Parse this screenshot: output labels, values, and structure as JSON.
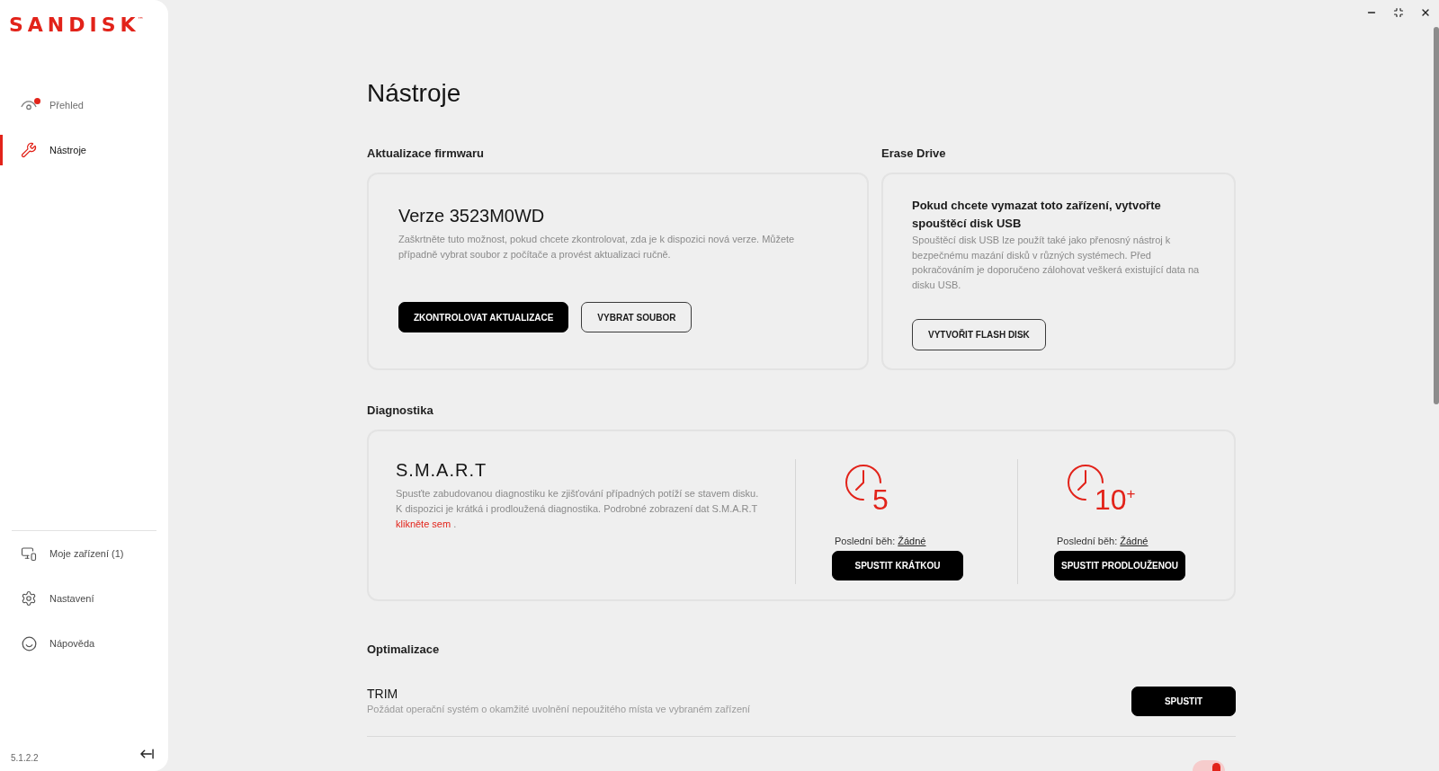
{
  "sidebar": {
    "logo": "SANDISK$^{™}$",
    "nav_items": [
      {
        "label": "Přehled",
        "selected": false,
        "notification": true
      },
      {
        "label": "Nástroje",
        "selected": true,
        "notification": false
      }
    ],
    "bottom_items": [
      {
        "label": "Moje zařízení (1)"
      },
      {
        "label": "Nastavení"
      },
      {
        "label": "Nápověda"
      }
    ],
    "version": "5.1.2.2"
  },
  "page": {
    "title": "Nástroje"
  },
  "firmware": {
    "heading": "Aktualizace firmwaru",
    "title": "Verze 3523M0WD",
    "description": "Zaškrtněte tuto možnost, pokud chcete zkontrolovat, zda je k dispozici nová verze. Můžete případně vybrat soubor z počítače a provést aktualizaci ručně.",
    "buttons": [
      {
        "label": "ZKONTROLOVAT AKTUALIZACE",
        "kind": "primary"
      },
      {
        "label": "VYBRAT SOUBOR",
        "kind": "outline"
      }
    ]
  },
  "erase_drive": {
    "heading": "Erase Drive",
    "title": "Pokud chcete vymazat toto zařízení, vytvořte spouštěcí disk USB",
    "description": "Spouštěcí disk USB lze použít také jako přenosný nástroj k bezpečnému mazání disků v různých systémech. Před pokračováním je doporučeno zálohovat veškerá existující data na disku USB.",
    "button": {
      "label": "VYTVOŘIT FLASH DISK",
      "kind": "outline"
    }
  },
  "diagnostics": {
    "heading": "Diagnostika",
    "title": "S.M.A.R.T",
    "description": "Spusťte zabudovanou diagnostiku ke zjišťování případných potíží se stavem disku. K dispozici je krátká i prodloužená diagnostika. Podrobné zobrazení dat S.M.A.R.T",
    "link": "klikněte sem",
    "after_link": ".",
    "tests": [
      {
        "duration": "5",
        "last_run_label": "Poslední běh:",
        "last_run_value": "Žádné",
        "button": {
          "label": "SPUSTIT KRÁTKOU",
          "kind": "primary"
        }
      },
      {
        "duration": "10$^{+}$",
        "last_run_label": "Poslední běh:",
        "last_run_value": "Žádné",
        "button": {
          "label": "SPUSTIT PRODLOUŽENOU",
          "kind": "primary"
        }
      }
    ]
  },
  "optimization": {
    "heading": "Optimalizace",
    "items": [
      {
        "title": "TRIM",
        "description": "Požádat operační systém o okamžité uvolnění nepoužitého místa ve vybraném zařízení",
        "button": {
          "label": "SPUSTIT",
          "kind": "primary"
        }
      }
    ],
    "toggle": {
      "on": true
    }
  }
}
